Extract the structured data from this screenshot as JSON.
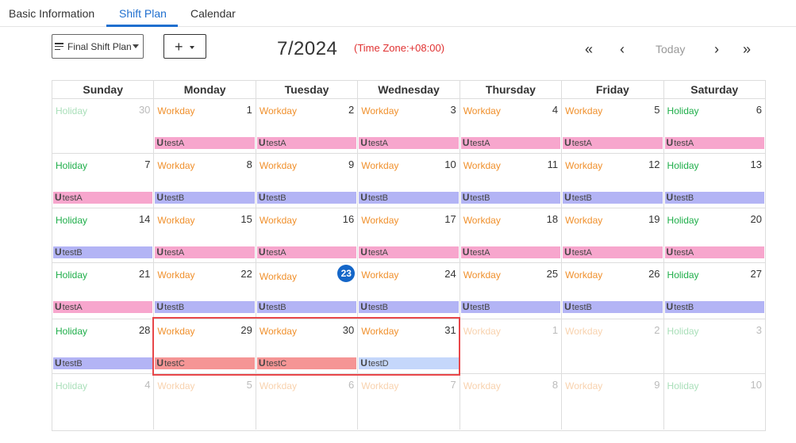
{
  "tabs": [
    {
      "label": "Basic Information",
      "active": false
    },
    {
      "label": "Shift Plan",
      "active": true
    },
    {
      "label": "Calendar",
      "active": false
    }
  ],
  "toolbar": {
    "plan_select_value": "Final Shift Plan",
    "add_label": "+",
    "month_title": "7/2024",
    "timezone": "(Time Zone:+08:00)",
    "nav": {
      "first": "«",
      "prev": "‹",
      "today": "Today",
      "next": "›",
      "last": "»"
    }
  },
  "calendar": {
    "weekdays": [
      "Sunday",
      "Monday",
      "Tuesday",
      "Wednesday",
      "Thursday",
      "Friday",
      "Saturday"
    ],
    "colors": {
      "testA": "#f7a6cd",
      "testB": "#b3b4f5",
      "testC": "#f59595",
      "testD": "#c5d7fb",
      "holiday": "#1fae4a",
      "workday": "#f0902c",
      "today": "#1466c8",
      "highlight": "#e8474a"
    },
    "weeks": [
      [
        {
          "type": "Holiday",
          "day": "30",
          "muted": true,
          "shift": null
        },
        {
          "type": "Workday",
          "day": "1",
          "muted": false,
          "shift": "testA"
        },
        {
          "type": "Workday",
          "day": "2",
          "muted": false,
          "shift": "testA"
        },
        {
          "type": "Workday",
          "day": "3",
          "muted": false,
          "shift": "testA"
        },
        {
          "type": "Workday",
          "day": "4",
          "muted": false,
          "shift": "testA"
        },
        {
          "type": "Workday",
          "day": "5",
          "muted": false,
          "shift": "testA"
        },
        {
          "type": "Holiday",
          "day": "6",
          "muted": false,
          "shift": "testA"
        }
      ],
      [
        {
          "type": "Holiday",
          "day": "7",
          "muted": false,
          "shift": "testA"
        },
        {
          "type": "Workday",
          "day": "8",
          "muted": false,
          "shift": "testB"
        },
        {
          "type": "Workday",
          "day": "9",
          "muted": false,
          "shift": "testB"
        },
        {
          "type": "Workday",
          "day": "10",
          "muted": false,
          "shift": "testB"
        },
        {
          "type": "Workday",
          "day": "11",
          "muted": false,
          "shift": "testB"
        },
        {
          "type": "Workday",
          "day": "12",
          "muted": false,
          "shift": "testB"
        },
        {
          "type": "Holiday",
          "day": "13",
          "muted": false,
          "shift": "testB"
        }
      ],
      [
        {
          "type": "Holiday",
          "day": "14",
          "muted": false,
          "shift": "testB"
        },
        {
          "type": "Workday",
          "day": "15",
          "muted": false,
          "shift": "testA"
        },
        {
          "type": "Workday",
          "day": "16",
          "muted": false,
          "shift": "testA"
        },
        {
          "type": "Workday",
          "day": "17",
          "muted": false,
          "shift": "testA"
        },
        {
          "type": "Workday",
          "day": "18",
          "muted": false,
          "shift": "testA"
        },
        {
          "type": "Workday",
          "day": "19",
          "muted": false,
          "shift": "testA"
        },
        {
          "type": "Holiday",
          "day": "20",
          "muted": false,
          "shift": "testA"
        }
      ],
      [
        {
          "type": "Holiday",
          "day": "21",
          "muted": false,
          "shift": "testA"
        },
        {
          "type": "Workday",
          "day": "22",
          "muted": false,
          "shift": "testB"
        },
        {
          "type": "Workday",
          "day": "23",
          "muted": false,
          "shift": "testB",
          "today": true
        },
        {
          "type": "Workday",
          "day": "24",
          "muted": false,
          "shift": "testB"
        },
        {
          "type": "Workday",
          "day": "25",
          "muted": false,
          "shift": "testB"
        },
        {
          "type": "Workday",
          "day": "26",
          "muted": false,
          "shift": "testB"
        },
        {
          "type": "Holiday",
          "day": "27",
          "muted": false,
          "shift": "testB"
        }
      ],
      [
        {
          "type": "Holiday",
          "day": "28",
          "muted": false,
          "shift": "testB"
        },
        {
          "type": "Workday",
          "day": "29",
          "muted": false,
          "shift": "testC"
        },
        {
          "type": "Workday",
          "day": "30",
          "muted": false,
          "shift": "testC"
        },
        {
          "type": "Workday",
          "day": "31",
          "muted": false,
          "shift": "testD"
        },
        {
          "type": "Workday",
          "day": "1",
          "muted": true,
          "shift": null
        },
        {
          "type": "Workday",
          "day": "2",
          "muted": true,
          "shift": null
        },
        {
          "type": "Holiday",
          "day": "3",
          "muted": true,
          "shift": null
        }
      ],
      [
        {
          "type": "Holiday",
          "day": "4",
          "muted": true,
          "shift": null
        },
        {
          "type": "Workday",
          "day": "5",
          "muted": true,
          "shift": null
        },
        {
          "type": "Workday",
          "day": "6",
          "muted": true,
          "shift": null
        },
        {
          "type": "Workday",
          "day": "7",
          "muted": true,
          "shift": null
        },
        {
          "type": "Workday",
          "day": "8",
          "muted": true,
          "shift": null
        },
        {
          "type": "Workday",
          "day": "9",
          "muted": true,
          "shift": null
        },
        {
          "type": "Holiday",
          "day": "10",
          "muted": true,
          "shift": null
        }
      ]
    ],
    "shift_prefix": "U"
  }
}
